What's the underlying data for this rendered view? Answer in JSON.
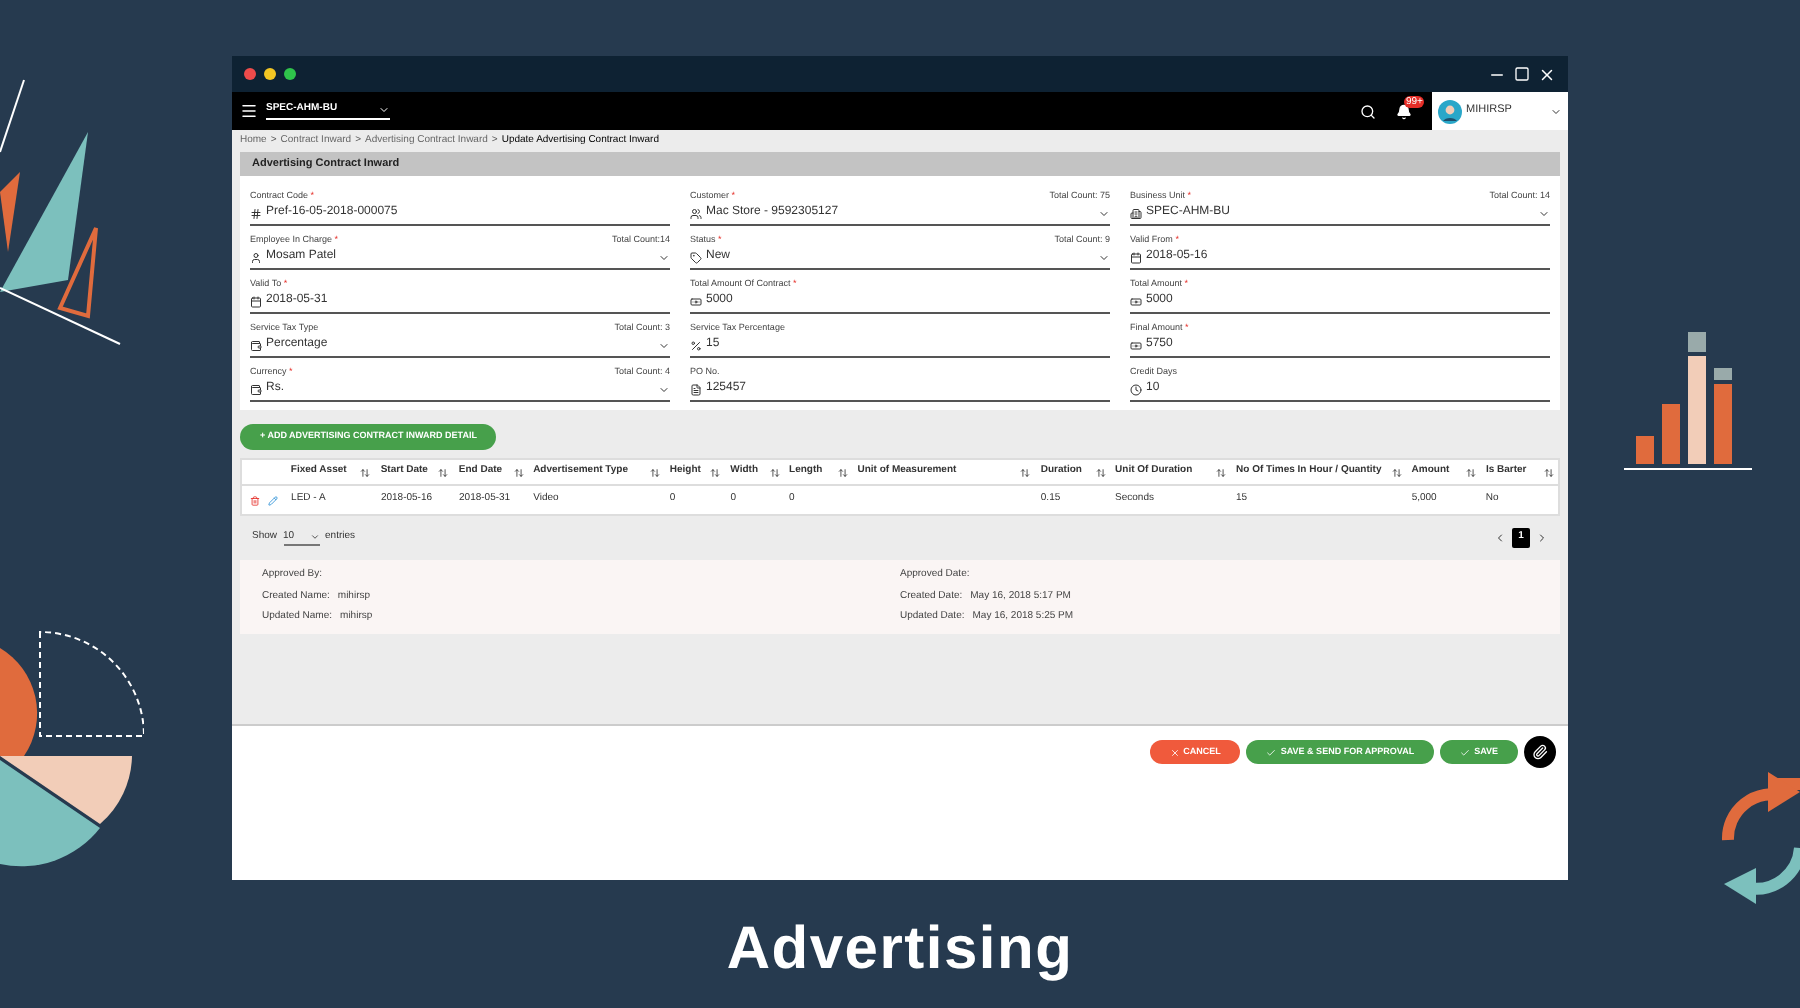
{
  "caption": "Advertising",
  "navbar": {
    "business_unit": "SPEC-AHM-BU",
    "notification_badge": "99+",
    "user": "MIHIRSP"
  },
  "breadcrumb_separator": ">",
  "breadcrumb": [
    {
      "label": "Home",
      "current": false
    },
    {
      "label": "Contract Inward",
      "current": false
    },
    {
      "label": "Advertising Contract Inward",
      "current": false
    },
    {
      "label": "Update Advertising Contract Inward",
      "current": true
    }
  ],
  "required_mark": "*",
  "panel_title": "Advertising Contract Inward",
  "fields": [
    {
      "label": "Contract Code",
      "required": true,
      "value": "Pref-16-05-2018-000075",
      "dropdown": false
    },
    {
      "label": "Customer",
      "required": true,
      "total_count": "Total Count: 75",
      "value": "Mac Store - 9592305127",
      "dropdown": true
    },
    {
      "label": "Business Unit",
      "required": true,
      "total_count": "Total Count: 14",
      "value": "SPEC-AHM-BU",
      "dropdown": true
    },
    {
      "label": "Employee In Charge",
      "required": true,
      "total_count": "Total Count:14",
      "value": "Mosam Patel",
      "dropdown": true
    },
    {
      "label": "Status",
      "required": true,
      "total_count": "Total Count: 9",
      "value": "New",
      "dropdown": true
    },
    {
      "label": "Valid From",
      "required": true,
      "value": "2018-05-16",
      "dropdown": false
    },
    {
      "label": "Valid To",
      "required": true,
      "value": "2018-05-31",
      "dropdown": false
    },
    {
      "label": "Total Amount Of Contract",
      "required": true,
      "value": "5000",
      "dropdown": false
    },
    {
      "label": "Total Amount",
      "required": true,
      "value": "5000",
      "dropdown": false
    },
    {
      "label": "Service Tax Type",
      "required": false,
      "total_count": "Total Count: 3",
      "value": "Percentage",
      "dropdown": true
    },
    {
      "label": "Service Tax Percentage",
      "required": false,
      "value": "15",
      "dropdown": false
    },
    {
      "label": "Final Amount",
      "required": true,
      "value": "5750",
      "dropdown": false
    },
    {
      "label": "Currency",
      "required": true,
      "total_count": "Total Count: 4",
      "value": "Rs.",
      "dropdown": true
    },
    {
      "label": "PO No.",
      "required": false,
      "value": "125457",
      "dropdown": false
    },
    {
      "label": "Credit Days",
      "required": false,
      "value": "10",
      "dropdown": false
    }
  ],
  "add_button": "+ ADD ADVERTISING CONTRACT INWARD DETAIL",
  "table": {
    "columns": [
      "Fixed Asset",
      "Start Date",
      "End Date",
      "Advertisement Type",
      "Height",
      "Width",
      "Length",
      "Unit of Measurement",
      "Duration",
      "Unit Of Duration",
      "No Of Times In Hour / Quantity",
      "Amount",
      "Is Barter"
    ],
    "rows": [
      {
        "cells": [
          "LED - A",
          "2018-05-16",
          "2018-05-31",
          "Video",
          "0",
          "0",
          "0",
          "",
          "0.15",
          "Seconds",
          "15",
          "5,000",
          "No"
        ]
      }
    ]
  },
  "page_size": {
    "show": "Show",
    "value": "10",
    "entries": "entries"
  },
  "pagination": [
    {
      "label": "1",
      "selected": true
    }
  ],
  "audit": [
    {
      "label": "Approved By:"
    },
    {
      "label": "Approved Date:"
    },
    {
      "label": "Created Name:",
      "value": "mihirsp"
    },
    {
      "label": "Created Date:",
      "value": "May 16, 2018 5:17 PM"
    },
    {
      "label": "Updated Name:",
      "value": "mihirsp"
    },
    {
      "label": "Updated Date:",
      "value": "May 16, 2018 5:25 PM"
    }
  ],
  "actions": [
    {
      "kind": "cancel",
      "label": "CANCEL"
    },
    {
      "kind": "approve",
      "label": "SAVE & SEND FOR APPROVAL"
    },
    {
      "kind": "save",
      "label": "SAVE"
    }
  ]
}
